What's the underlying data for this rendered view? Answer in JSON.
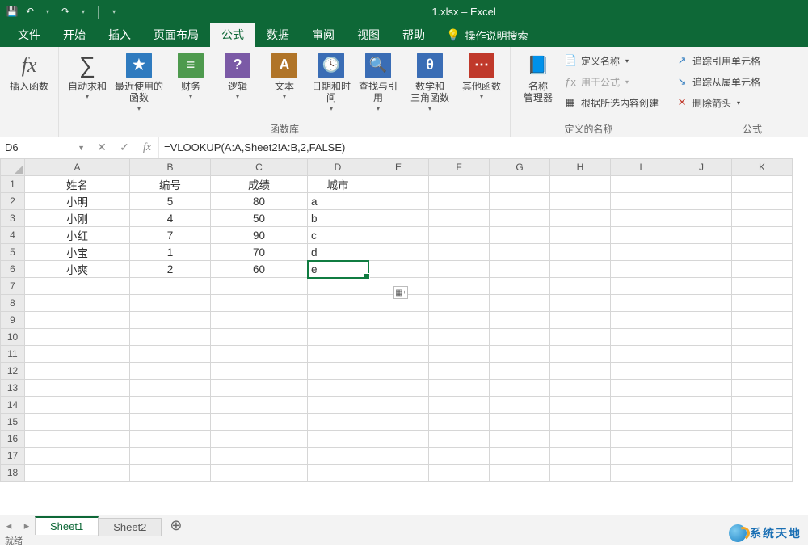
{
  "title": "1.xlsx – Excel",
  "qat": {
    "undo": "↶",
    "redo": "↷"
  },
  "menu": {
    "items": [
      "文件",
      "开始",
      "插入",
      "页面布局",
      "公式",
      "数据",
      "审阅",
      "视图",
      "帮助"
    ],
    "active_index": 4,
    "tell_me": "操作说明搜索"
  },
  "ribbon": {
    "insert_fn": {
      "label": "插入函数",
      "symbol": "fx"
    },
    "library": {
      "label": "函数库",
      "items": [
        {
          "label": "自动求和",
          "icon": "∑",
          "bg": ""
        },
        {
          "label": "最近使用的\n函数",
          "icon": "★",
          "bg": "#2f7bbf"
        },
        {
          "label": "财务",
          "icon": "≡",
          "bg": "#4e9a4e"
        },
        {
          "label": "逻辑",
          "icon": "?",
          "bg": "#7b5aa6"
        },
        {
          "label": "文本",
          "icon": "A",
          "bg": "#b07428"
        },
        {
          "label": "日期和时间",
          "icon": "🕓",
          "bg": "#3a6db5"
        },
        {
          "label": "查找与引用",
          "icon": "🔍",
          "bg": "#3a6db5"
        },
        {
          "label": "数学和\n三角函数",
          "icon": "θ",
          "bg": "#3a6db5"
        },
        {
          "label": "其他函数",
          "icon": "⋯",
          "bg": "#c0392b"
        }
      ]
    },
    "names": {
      "label": "定义的名称",
      "manager": "名称\n管理器",
      "items": [
        "定义名称",
        "用于公式",
        "根据所选内容创建"
      ]
    },
    "audit": {
      "items": [
        "追踪引用单元格",
        "追踪从属单元格",
        "删除箭头"
      ]
    },
    "far": "公式"
  },
  "namebox": "D6",
  "formula": "=VLOOKUP(A:A,Sheet2!A:B,2,FALSE)",
  "columns": [
    "A",
    "B",
    "C",
    "D",
    "E",
    "F",
    "G",
    "H",
    "I",
    "J",
    "K"
  ],
  "rownums": [
    1,
    2,
    3,
    4,
    5,
    6,
    7,
    8,
    9,
    10,
    11,
    12,
    13,
    14,
    15,
    16,
    17,
    18
  ],
  "data": {
    "headers": [
      "姓名",
      "编号",
      "成绩",
      "城市"
    ],
    "rows": [
      [
        "小明",
        "5",
        "80",
        "a"
      ],
      [
        "小刚",
        "4",
        "50",
        "b"
      ],
      [
        "小红",
        "7",
        "90",
        "c"
      ],
      [
        "小宝",
        "1",
        "70",
        "d"
      ],
      [
        "小爽",
        "2",
        "60",
        "e"
      ]
    ]
  },
  "selected_cell": "D6",
  "sheets": {
    "tabs": [
      "Sheet1",
      "Sheet2"
    ],
    "active": 0,
    "add": "⊕"
  },
  "status": "就绪",
  "watermark": "系统天地"
}
